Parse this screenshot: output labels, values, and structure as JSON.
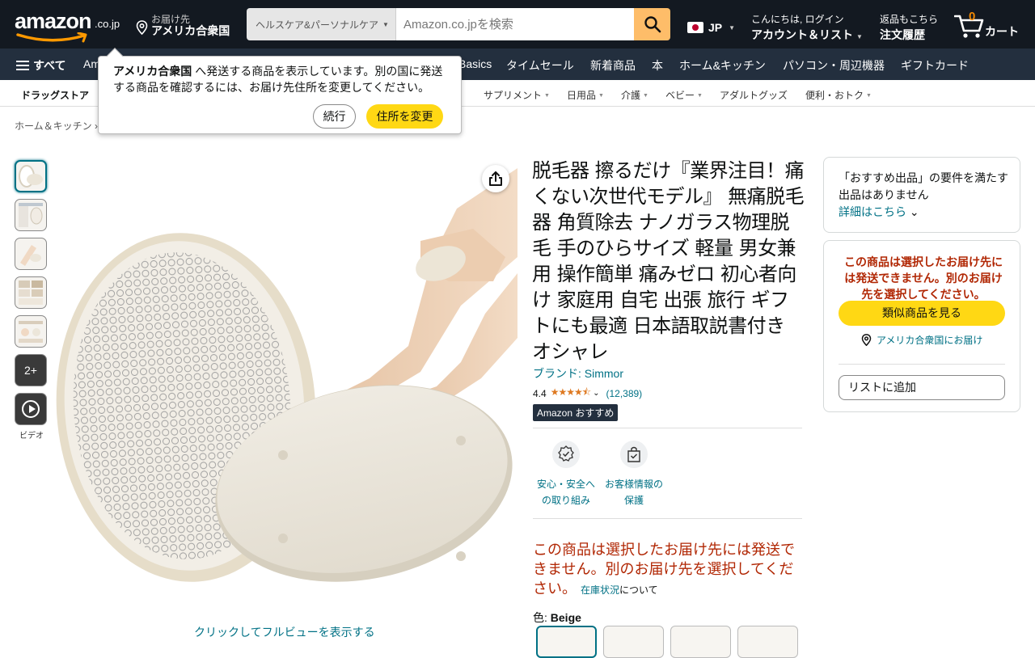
{
  "header": {
    "logo_text": "amazon",
    "logo_tld": ".co.jp",
    "deliver_to_label": "お届け先",
    "deliver_to_location": "アメリカ合衆国",
    "search_category": "ヘルスケア&パーソナルケア",
    "search_placeholder": "Amazon.co.jpを検索",
    "language": "JP",
    "account_greeting": "こんにちは, ログイン",
    "account_label": "アカウント＆リスト",
    "returns_label": "返品もこちら",
    "orders_label": "注文履歴",
    "cart_count": "0",
    "cart_label": "カート"
  },
  "subnav": {
    "all_label": "すべて",
    "items": [
      "Am",
      "Basics",
      "タイムセール",
      "新着商品",
      "本",
      "ホーム&キッチン",
      "パソコン・周辺機器",
      "ギフトカード"
    ]
  },
  "category_nav": {
    "store": "ドラッグストア",
    "items": [
      "サプリメント",
      "日用品",
      "介護",
      "ベビー",
      "アダルトグッズ",
      "便利・おトク"
    ]
  },
  "breadcrumb": "ホーム＆キッチン ›",
  "popover": {
    "bold_text": "アメリカ合衆国",
    "message": " へ発送する商品を表示しています。別の国に発送する商品を確認するには、お届け先住所を変更してください。",
    "continue_label": "続行",
    "change_address_label": "住所を変更"
  },
  "gallery": {
    "more_count": "2+",
    "video_label": "ビデオ",
    "full_view_label": "クリックしてフルビューを表示する"
  },
  "product": {
    "title": "脱毛器 擦るだけ『業界注目！痛くない次世代モデル』 無痛脱毛器 角質除去 ナノガラス物理脱毛 手のひらサイズ 軽量 男女兼用 操作簡単 痛みゼロ 初心者向け 家庭用 自宅 出張 旅行 ギフトにも最適 日本語取説書付き オシャレ",
    "brand": "ブランド: Simmor",
    "rating": "4.4",
    "rating_value": 4.4,
    "review_count": "(12,389)",
    "badge": "Amazon おすすめ",
    "features": [
      {
        "label": "安心・安全への取り組み",
        "icon": "shield-check-icon"
      },
      {
        "label": "お客様情報の保護",
        "icon": "secure-bag-icon"
      }
    ],
    "unavailable_message": "この商品は選択したお届け先には発送できません。別のお届け先を選択してください。",
    "stock_link": "在庫状況",
    "stock_suffix": "について",
    "color_label": "色: ",
    "color_value": "Beige"
  },
  "buybox": {
    "recommend_text": "「おすすめ出品」の要件を満たす出品はありません",
    "details_link": "詳細はこちら",
    "not_shippable": "この商品は選択したお届け先には発送できません。別のお届け先を選択してください。",
    "similar_button": "類似商品を見る",
    "deliver_to": "アメリカ合衆国にお届け",
    "add_to_list": "リストに追加"
  },
  "colors": {
    "nav_bg": "#131921",
    "subnav_bg": "#232f3e",
    "accent_yellow": "#ffd814",
    "search_button": "#febd69",
    "link": "#007185",
    "alert_red": "#b12704",
    "star": "#de7921"
  }
}
